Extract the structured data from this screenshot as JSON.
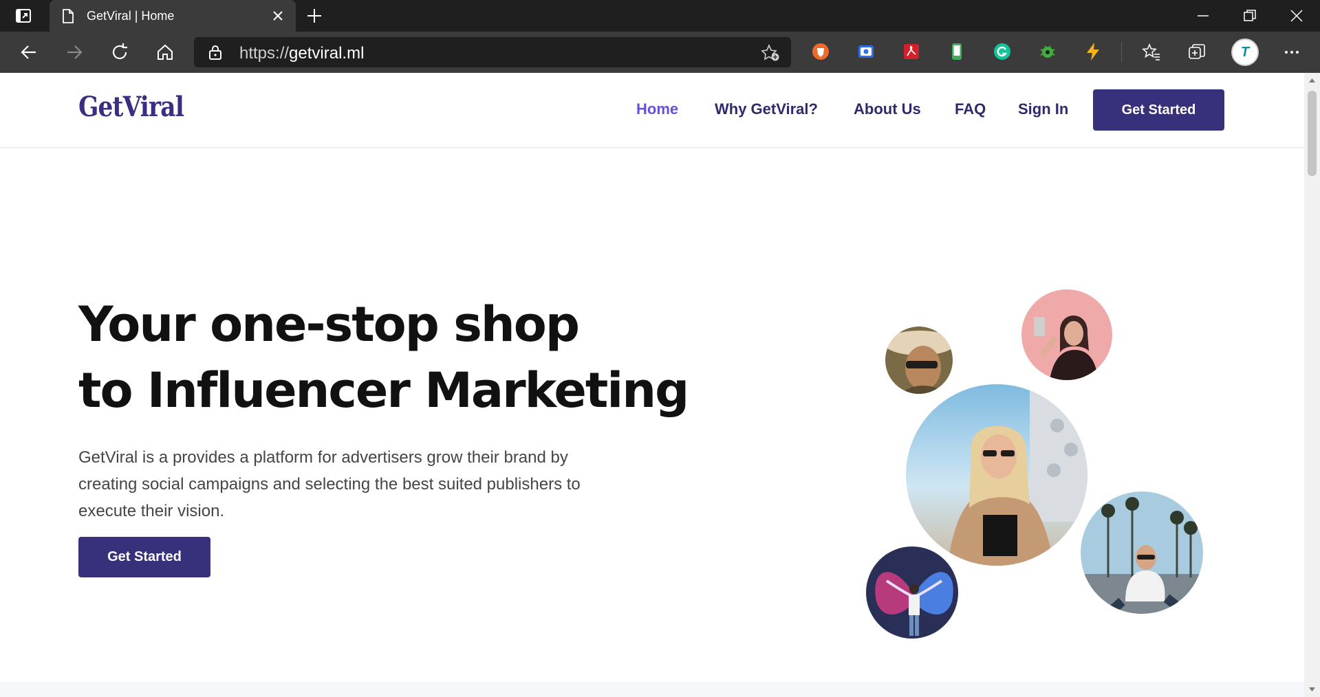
{
  "browser": {
    "tab_title": "GetViral | Home",
    "url_protocol": "https://",
    "url_host": "getviral.ml",
    "profile_letter": "T"
  },
  "site": {
    "logo": "GetViral",
    "nav": {
      "home": "Home",
      "why": "Why GetViral?",
      "about": "About Us",
      "faq": "FAQ",
      "signin": "Sign In",
      "cta": "Get Started"
    },
    "hero": {
      "title_line1": "Your one-stop shop",
      "title_line2": "to Influencer Marketing",
      "description": "GetViral is a provides a platform for advertisers grow their brand by creating social campaigns and selecting the best suited publishers to execute their vision.",
      "cta": "Get Started"
    }
  },
  "colors": {
    "brand": "#37307a",
    "nav_active": "#6a4fd8",
    "nav_text": "#2f2a6b"
  }
}
